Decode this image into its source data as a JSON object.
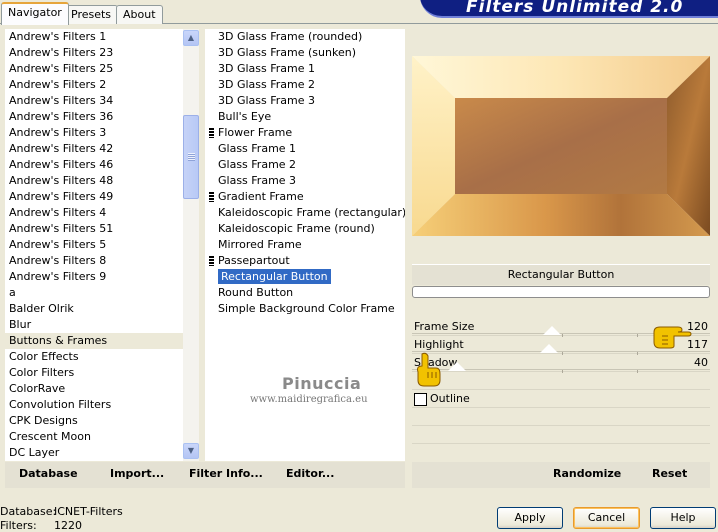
{
  "app_title": "Filters Unlimited 2.0",
  "tabs": [
    {
      "label": "Navigator",
      "active": true
    },
    {
      "label": "Presets",
      "active": false
    },
    {
      "label": "About",
      "active": false
    }
  ],
  "categories": [
    "Andrew's Filters 1",
    "Andrew's Filters 23",
    "Andrew's Filters 25",
    "Andrew's Filters 2",
    "Andrew's Filters 34",
    "Andrew's Filters 36",
    "Andrew's Filters 3",
    "Andrew's Filters 42",
    "Andrew's Filters 46",
    "Andrew's Filters 48",
    "Andrew's Filters 49",
    "Andrew's Filters 4",
    "Andrew's Filters 51",
    "Andrew's Filters 5",
    "Andrew's Filters 8",
    "Andrew's Filters 9",
    "a",
    "Balder Olrik",
    "Blur",
    "Buttons & Frames",
    "Color Effects",
    "Color Filters",
    "ColorRave",
    "Convolution Filters",
    "CPK Designs",
    "Crescent Moon",
    "DC Layer"
  ],
  "selected_category": "Buttons & Frames",
  "filters": [
    {
      "label": "3D Glass Frame (rounded)",
      "group": false
    },
    {
      "label": "3D Glass Frame (sunken)",
      "group": false
    },
    {
      "label": "3D Glass Frame 1",
      "group": false
    },
    {
      "label": "3D Glass Frame 2",
      "group": false
    },
    {
      "label": "3D Glass Frame 3",
      "group": false
    },
    {
      "label": "Bull's Eye",
      "group": false
    },
    {
      "label": "Flower Frame",
      "group": true
    },
    {
      "label": "Glass Frame 1",
      "group": false
    },
    {
      "label": "Glass Frame 2",
      "group": false
    },
    {
      "label": "Glass Frame 3",
      "group": false
    },
    {
      "label": "Gradient Frame",
      "group": true
    },
    {
      "label": "Kaleidoscopic Frame (rectangular)",
      "group": false
    },
    {
      "label": "Kaleidoscopic Frame (round)",
      "group": false
    },
    {
      "label": "Mirrored Frame",
      "group": false
    },
    {
      "label": "Passepartout",
      "group": true
    },
    {
      "label": "Rectangular Button",
      "group": false
    },
    {
      "label": "Round Button",
      "group": false
    },
    {
      "label": "Simple Background Color Frame",
      "group": false
    }
  ],
  "selected_filter": "Rectangular Button",
  "preview_caption": "Rectangular Button",
  "parameters": [
    {
      "label": "Frame Size",
      "value": "120",
      "level": 0.47
    },
    {
      "label": "Highlight",
      "value": "117",
      "level": 0.46
    },
    {
      "label": "Shadow",
      "value": "40",
      "level": 0.15
    }
  ],
  "outline": {
    "label": "Outline",
    "checked": false
  },
  "toolbar": {
    "database": "Database",
    "import": "Import...",
    "filter_info": "Filter Info...",
    "editor": "Editor...",
    "randomize": "Randomize",
    "reset": "Reset"
  },
  "status": {
    "database_key": "Database:",
    "database_value": "ICNET-Filters",
    "filters_key": "Filters:",
    "filters_value": "1220"
  },
  "buttons": {
    "apply": "Apply",
    "cancel": "Cancel",
    "help": "Help"
  },
  "watermark": {
    "title": "Pinuccia",
    "url": "www.maidiregrafica.eu"
  },
  "colors": {
    "selection": "#316ac5",
    "banner": "#0f1f82",
    "hand": "#f2c200"
  }
}
